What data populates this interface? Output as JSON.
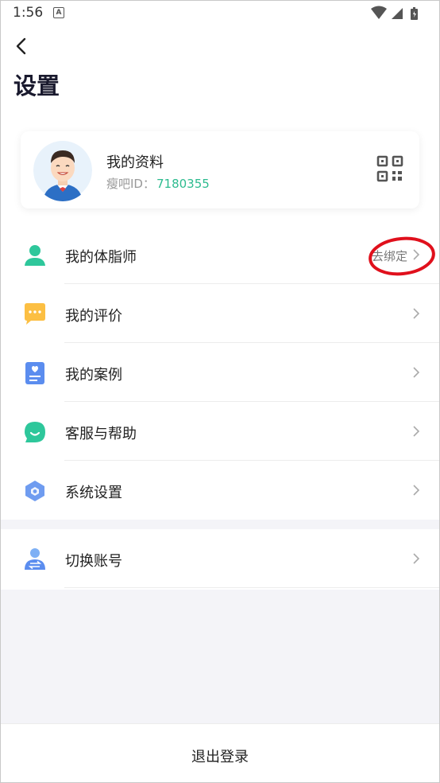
{
  "status_bar": {
    "time": "1:56",
    "notification_badge": "A",
    "icons": [
      "wifi-icon",
      "signal-icon",
      "battery-icon"
    ]
  },
  "header": {
    "back_icon": "back-arrow-icon",
    "title": "设置"
  },
  "profile": {
    "name": "我的资料",
    "id_label": "瘦吧ID：",
    "id_value": "7180355",
    "qr_icon": "qr-code-icon"
  },
  "menu": {
    "items": [
      {
        "label": "我的体脂师",
        "icon": "person-icon",
        "extra": "去绑定"
      },
      {
        "label": "我的评价",
        "icon": "message-icon",
        "extra": ""
      },
      {
        "label": "我的案例",
        "icon": "case-card-icon",
        "extra": ""
      },
      {
        "label": "客服与帮助",
        "icon": "service-chat-icon",
        "extra": ""
      },
      {
        "label": "系统设置",
        "icon": "settings-hex-icon",
        "extra": ""
      }
    ]
  },
  "switch_account": {
    "label": "切换账号",
    "icon": "switch-account-icon"
  },
  "logout": {
    "label": "退出登录"
  },
  "colors": {
    "accent": "#2dbb8f",
    "annotation_red": "#e0101c"
  }
}
